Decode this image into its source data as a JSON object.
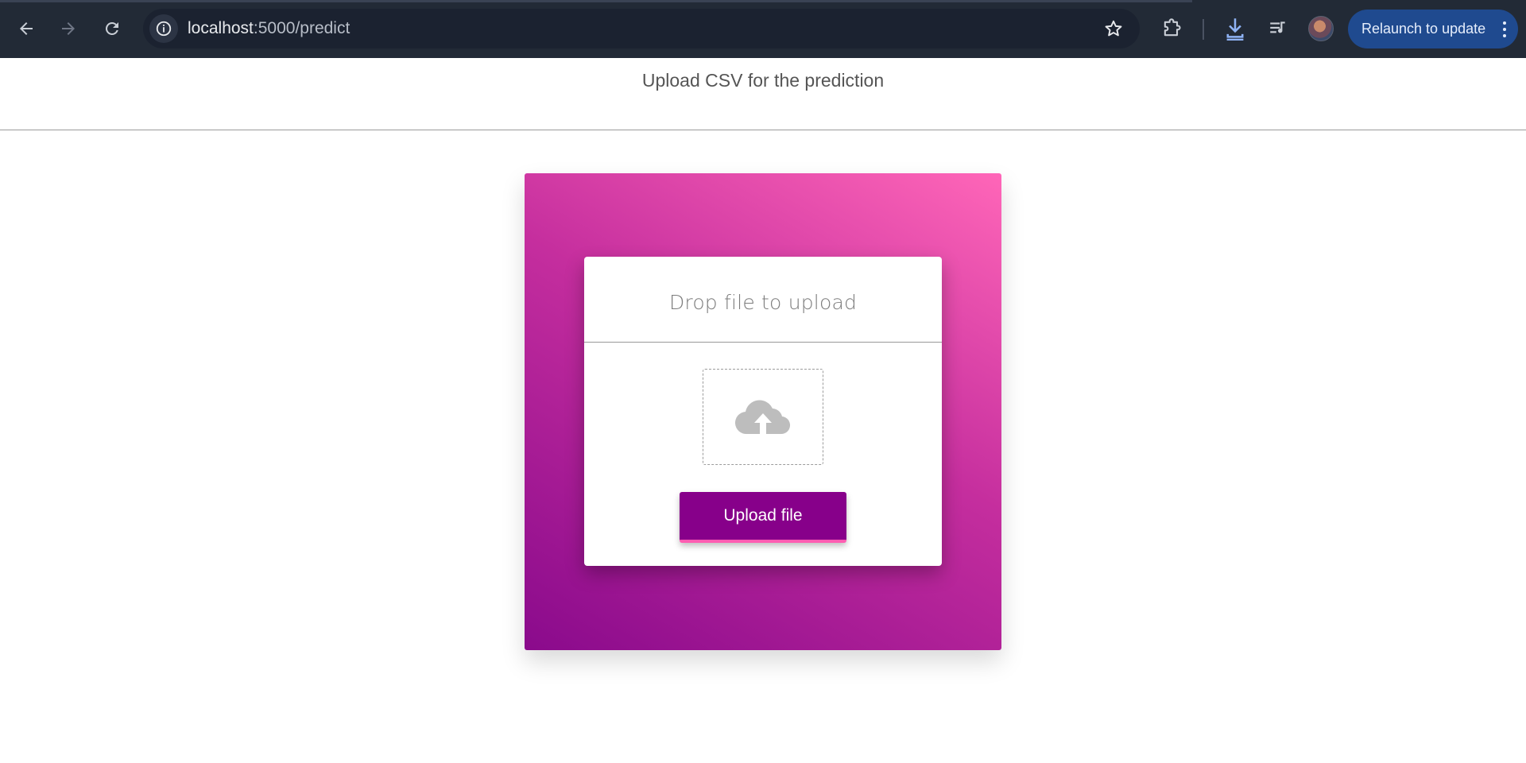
{
  "browser": {
    "url_host": "localhost",
    "url_path": ":5000/predict",
    "relaunch_label": "Relaunch to update",
    "icons": {
      "back": "back-arrow-icon",
      "forward": "forward-arrow-icon",
      "reload": "reload-icon",
      "site_info": "info-icon",
      "bookmark": "star-icon",
      "extensions": "puzzle-icon",
      "downloads": "download-icon",
      "media": "media-queue-icon",
      "menu": "kebab-menu-icon"
    },
    "colors": {
      "toolbar": "#222a36",
      "omnibox": "#1b2230",
      "relaunch": "#1f4a8f"
    }
  },
  "page": {
    "title": "Upload CSV for the prediction"
  },
  "upload_card": {
    "title": "Drop file to upload",
    "dropzone_icon": "cloud-upload-icon",
    "button_label": "Upload file",
    "colors": {
      "gradient_start": "#8a0a8c",
      "gradient_end": "#ff66b8",
      "button": "#87008a",
      "button_accent": "#ff5db2"
    }
  }
}
